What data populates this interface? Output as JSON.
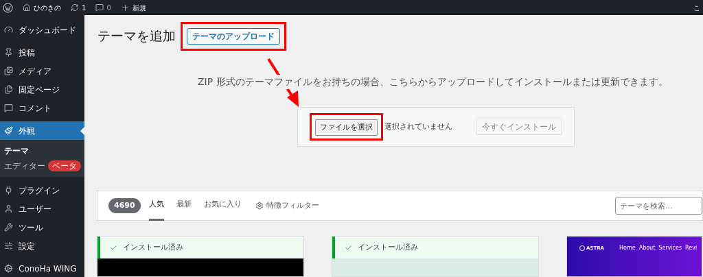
{
  "admin_bar": {
    "site_name": "ひのきの",
    "updates": "1",
    "comments": "0",
    "new_label": "新規",
    "right_text": "こ"
  },
  "sidebar": {
    "items": [
      {
        "label": "ダッシュボード",
        "selected": false
      },
      {
        "label": "投稿",
        "selected": false
      },
      {
        "label": "メディア",
        "selected": false
      },
      {
        "label": "固定ページ",
        "selected": false
      },
      {
        "label": "コメント",
        "selected": false
      },
      {
        "label": "外観",
        "selected": true,
        "children": [
          {
            "label": "テーマ",
            "selected": true
          },
          {
            "label": "エディター",
            "selected": false,
            "badge": "ベータ"
          }
        ]
      },
      {
        "label": "プラグイン",
        "selected": false
      },
      {
        "label": "ユーザー",
        "selected": false
      },
      {
        "label": "ツール",
        "selected": false
      },
      {
        "label": "設定",
        "selected": false
      },
      {
        "label": "ConoHa WING",
        "selected": false
      }
    ]
  },
  "page": {
    "title": "テーマを追加",
    "upload_button": "テーマのアップロード"
  },
  "upload": {
    "description": "ZIP 形式のテーマファイルをお持ちの場合、こちらからアップロードしてインストールまたは更新できます。",
    "file_button": "ファイルを選択",
    "file_status": "選択されていません",
    "install_button": "今すぐインストール",
    "install_disabled": true
  },
  "filter_bar": {
    "count": "4690",
    "tabs": [
      {
        "label": "人気",
        "selected": true
      },
      {
        "label": "最新",
        "selected": false
      },
      {
        "label": "お気に入り",
        "selected": false
      }
    ],
    "feature_filter": "特徴フィルター",
    "search": {
      "placeholder": "テーマを検索..."
    }
  },
  "themes": [
    {
      "installed": true,
      "notice": "インストール済み",
      "kind": "dark"
    },
    {
      "installed": true,
      "notice": "インストール済み",
      "kind": "light"
    },
    {
      "installed": false,
      "kind": "astra",
      "logo": "ASTRA",
      "nav": [
        "Home",
        "About",
        "Services",
        "Revi"
      ]
    }
  ]
}
